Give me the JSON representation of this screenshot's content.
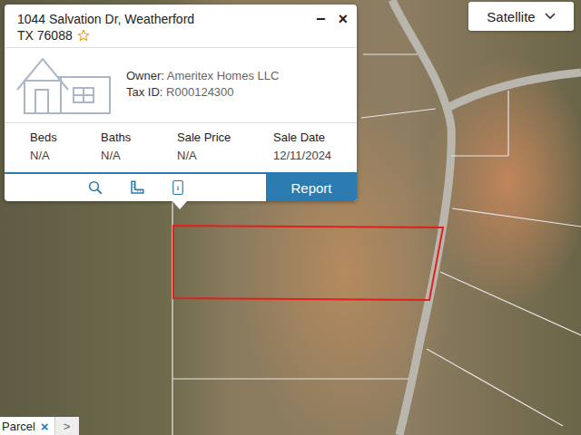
{
  "map_type": {
    "label": "Satellite"
  },
  "popup": {
    "address_line1": "1044 Salvation Dr, Weatherford",
    "address_line2": "TX 76088",
    "favorite": false,
    "minimize": "−",
    "close": "×",
    "owner_label": "Owner:",
    "owner": "Ameritex Homes LLC",
    "tax_label": "Tax ID:",
    "tax_id": "R000124300",
    "fields": [
      {
        "label": "Beds",
        "value": "N/A"
      },
      {
        "label": "Baths",
        "value": "N/A"
      },
      {
        "label": "Sale Price",
        "value": "N/A"
      },
      {
        "label": "Sale Date",
        "value": "12/11/2024"
      }
    ],
    "report_button": "Report"
  },
  "bottom_tab": {
    "label": "Parcel",
    "close": "×",
    "next": ">"
  }
}
